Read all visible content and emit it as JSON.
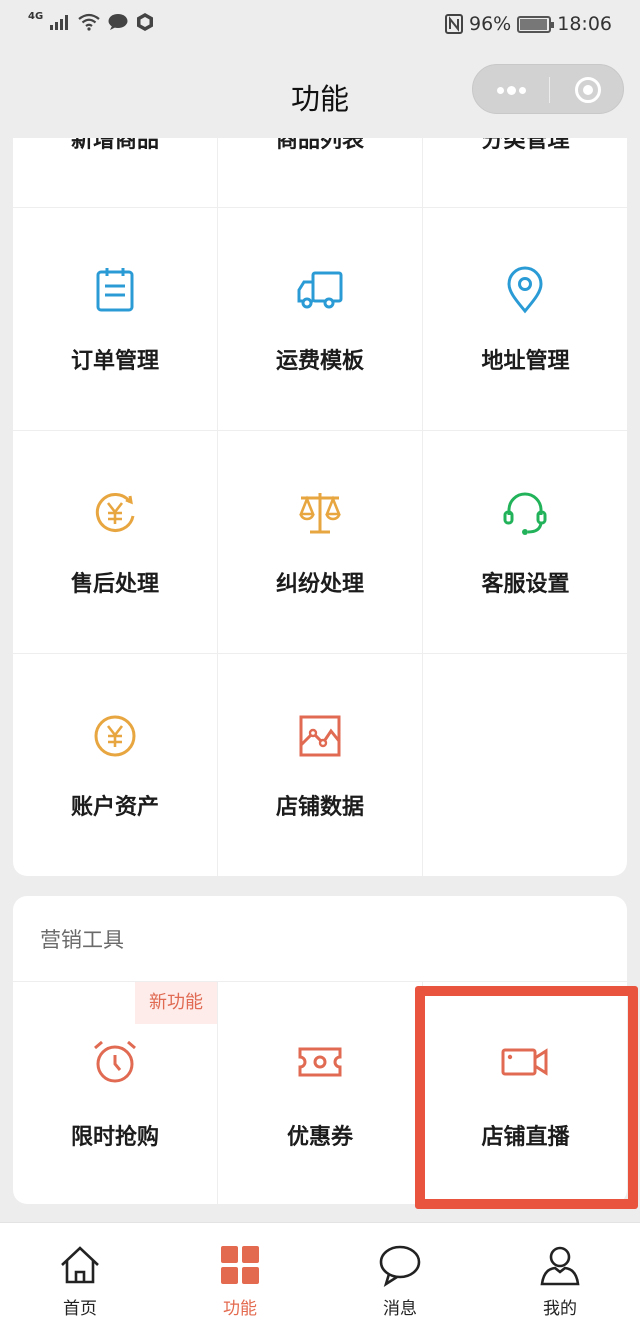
{
  "status_bar": {
    "network": "4G",
    "battery_percent": "96%",
    "time": "18:06"
  },
  "header": {
    "title": "功能"
  },
  "function_grid": [
    {
      "label": "新增商品",
      "icon": "add-product-icon"
    },
    {
      "label": "商品列表",
      "icon": "product-list-icon"
    },
    {
      "label": "分类管理",
      "icon": "category-icon"
    },
    {
      "label": "订单管理",
      "icon": "clipboard-icon",
      "color": "#2b9bd6"
    },
    {
      "label": "运费模板",
      "icon": "truck-icon",
      "color": "#2b9bd6"
    },
    {
      "label": "地址管理",
      "icon": "location-pin-icon",
      "color": "#2b9bd6"
    },
    {
      "label": "售后处理",
      "icon": "yen-refresh-icon",
      "color": "#e8a641"
    },
    {
      "label": "纠纷处理",
      "icon": "scale-icon",
      "color": "#e8a641"
    },
    {
      "label": "客服设置",
      "icon": "headset-icon",
      "color": "#22b35a"
    },
    {
      "label": "账户资产",
      "icon": "yen-circle-icon",
      "color": "#e8a641"
    },
    {
      "label": "店铺数据",
      "icon": "line-chart-icon",
      "color": "#e06a52"
    }
  ],
  "marketing": {
    "title": "营销工具",
    "badge": "新功能",
    "items": [
      {
        "label": "限时抢购",
        "icon": "alarm-clock-icon",
        "color": "#e06a52"
      },
      {
        "label": "优惠券",
        "icon": "coupon-icon",
        "color": "#e06a52"
      },
      {
        "label": "店铺直播",
        "icon": "video-camera-icon",
        "color": "#e06a52"
      }
    ]
  },
  "highlight_color": "#e8543e",
  "tab_bar": {
    "items": [
      {
        "label": "首页",
        "icon": "home-icon"
      },
      {
        "label": "功能",
        "icon": "grid-icon",
        "active": true,
        "color": "#e36a4f"
      },
      {
        "label": "消息",
        "icon": "chat-bubble-icon"
      },
      {
        "label": "我的",
        "icon": "user-icon"
      }
    ]
  }
}
